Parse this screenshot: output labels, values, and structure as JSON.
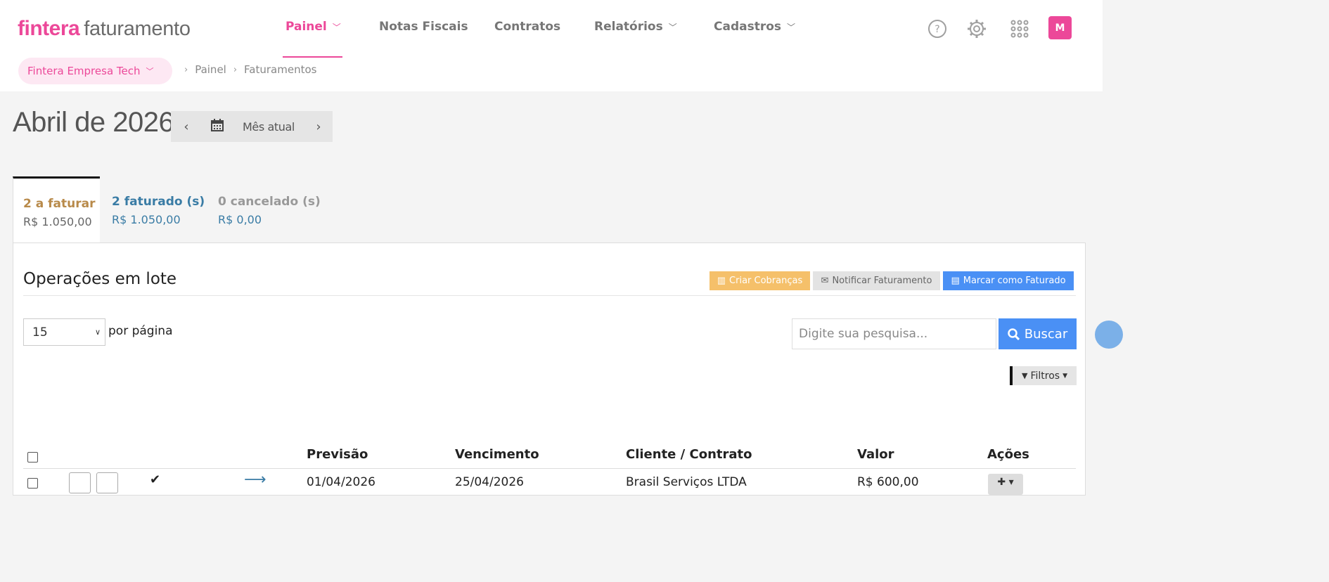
{
  "header": {
    "logo_brand": "fintera",
    "logo_product": "faturamento",
    "nav": [
      {
        "label": "Painel",
        "active": true,
        "dropdown": true
      },
      {
        "label": "Notas Fiscais",
        "active": false,
        "dropdown": false
      },
      {
        "label": "Contratos",
        "active": false,
        "dropdown": false
      },
      {
        "label": "Relatórios",
        "active": false,
        "dropdown": true
      },
      {
        "label": "Cadastros",
        "active": false,
        "dropdown": true
      }
    ],
    "icons": [
      "help-icon",
      "gear-icon",
      "apps-grid-icon"
    ],
    "avatar_initial": "M",
    "accent_color": "#ec4899"
  },
  "company": {
    "name": "Fintera Empresa Tech"
  },
  "breadcrumb": [
    "Painel",
    "Faturamentos"
  ],
  "month": {
    "title": "Abril de 2026",
    "current_label": "Mês atual"
  },
  "tabs": [
    {
      "title": "2 a faturar",
      "amount": "R$ 1.050,00",
      "active": true,
      "color": "#b88a4a"
    },
    {
      "title": "2 faturado (s)",
      "amount": "R$ 1.050,00",
      "active": false,
      "color": "#3a7ca5"
    },
    {
      "title": "0 cancelado (s)",
      "amount": "R$ 0,00",
      "active": false,
      "color": "#999999"
    }
  ],
  "bulk": {
    "title": "Operações em lote",
    "create_charges": "Criar Cobranças",
    "notify_billing": "Notificar Faturamento",
    "mark_billed": "Marcar como Faturado"
  },
  "pagination": {
    "per_page_value": "15",
    "per_page_label": "por página"
  },
  "search": {
    "placeholder": "Digite sua pesquisa...",
    "button": "Buscar"
  },
  "filters": {
    "label": "Filtros"
  },
  "table": {
    "columns": [
      "Previsão",
      "Vencimento",
      "Cliente / Contrato",
      "Valor",
      "Ações"
    ],
    "rows": [
      {
        "previsao": "01/04/2026",
        "vencimento": "25/04/2026",
        "cliente": "Brasil Serviços LTDA",
        "valor": "R$ 600,00"
      }
    ]
  }
}
